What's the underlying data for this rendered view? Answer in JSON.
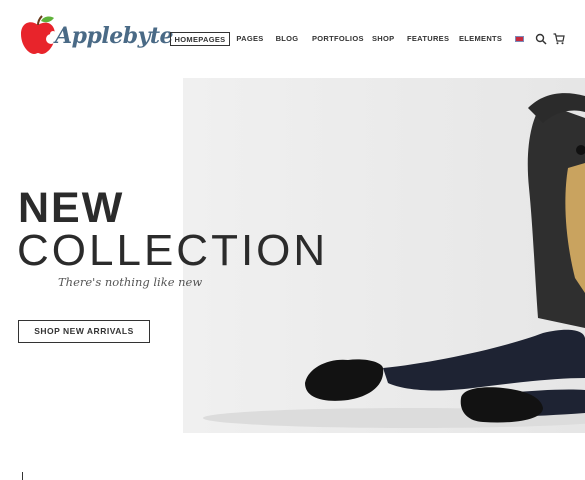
{
  "header": {
    "logo_text": "Applebyte",
    "nav": [
      {
        "label": "HOMEPAGES",
        "active": true
      },
      {
        "label": "PAGES"
      },
      {
        "label": "BLOG"
      },
      {
        "label": "PORTFOLIOS"
      },
      {
        "label": "SHOP"
      },
      {
        "label": "FEATURES"
      },
      {
        "label": "ELEMENTS"
      }
    ],
    "icons": [
      "flag-uk-icon",
      "search-icon",
      "cart-icon"
    ]
  },
  "hero": {
    "title_line1": "NEW",
    "title_line2": "COLLECTION",
    "subtitle": "There's nothing like new",
    "cta_label": "SHOP NEW ARRIVALS"
  },
  "colors": {
    "logo_red": "#e8242b",
    "logo_green": "#5fb23a",
    "logo_text": "#4a6a86",
    "text_dark": "#2b2b2b",
    "hero_bg": "#ececec"
  }
}
